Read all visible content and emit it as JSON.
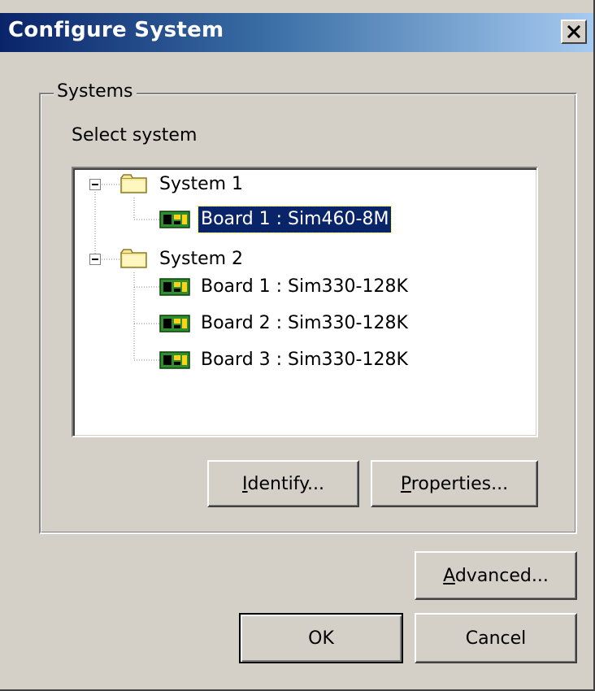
{
  "window": {
    "title": "Configure System",
    "close_glyph": "✕"
  },
  "systems_group": {
    "label": "Systems",
    "select_label": "Select system"
  },
  "tree": {
    "systems": [
      {
        "label": "System 1",
        "boards": [
          {
            "label": "Board 1 : Sim460-8M",
            "selected": true
          }
        ]
      },
      {
        "label": "System 2",
        "boards": [
          {
            "label": "Board 1 : Sim330-128K"
          },
          {
            "label": "Board 2 : Sim330-128K"
          },
          {
            "label": "Board 3 : Sim330-128K"
          }
        ]
      }
    ],
    "icons": {
      "system": "folder-icon",
      "board": "circuit-board-icon"
    }
  },
  "buttons": {
    "identify": {
      "mnemonic": "I",
      "rest": "dentify..."
    },
    "properties": {
      "mnemonic": "P",
      "rest": "roperties..."
    },
    "advanced": {
      "mnemonic": "A",
      "rest": "dvanced..."
    },
    "ok": "OK",
    "cancel": "Cancel"
  },
  "colors": {
    "face": "#d4d0c8",
    "title_start": "#0a246a",
    "title_end": "#a6caf0",
    "selection": "#0a246a"
  }
}
